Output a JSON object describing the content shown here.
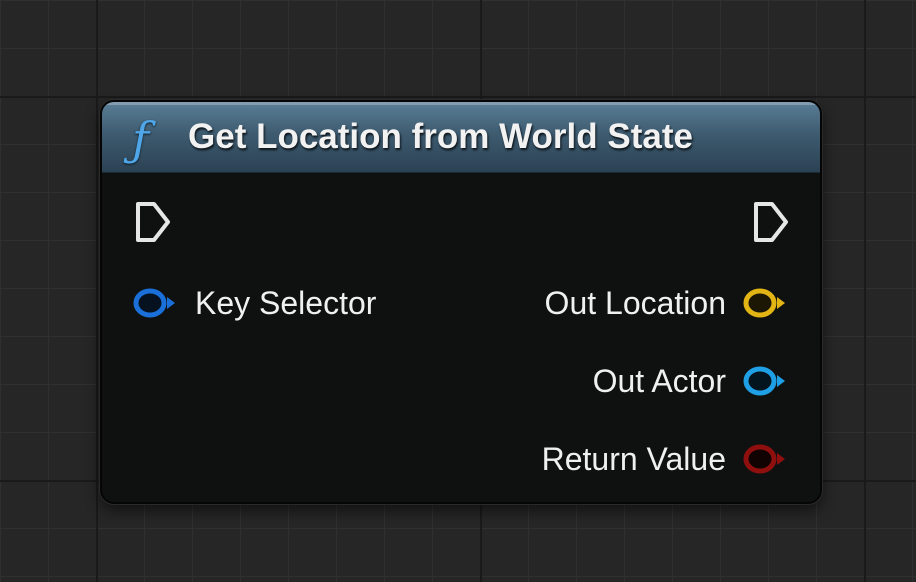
{
  "node": {
    "icon": "function-icon",
    "title": "Get Location from World State"
  },
  "inputs": [
    {
      "label": "Key Selector",
      "color": "#1a6fd9"
    }
  ],
  "outputs": [
    {
      "label": "Out Location",
      "color": "#e3b514"
    },
    {
      "label": "Out Actor",
      "color": "#1fa0e6"
    },
    {
      "label": "Return Value",
      "color": "#8f0f0f"
    }
  ],
  "colors": {
    "header": "#3e5b70",
    "body": "#0f1110",
    "exec_pin": "#e6e6e6"
  }
}
